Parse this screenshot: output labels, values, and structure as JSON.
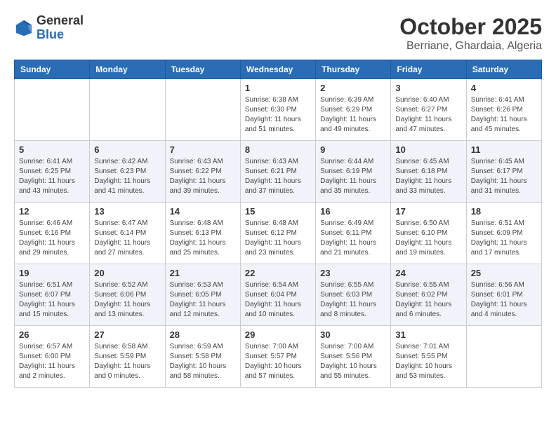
{
  "header": {
    "logo": {
      "line1": "General",
      "line2": "Blue"
    },
    "month": "October 2025",
    "location": "Berriane, Ghardaia, Algeria"
  },
  "weekdays": [
    "Sunday",
    "Monday",
    "Tuesday",
    "Wednesday",
    "Thursday",
    "Friday",
    "Saturday"
  ],
  "weeks": [
    [
      {
        "day": "",
        "info": ""
      },
      {
        "day": "",
        "info": ""
      },
      {
        "day": "",
        "info": ""
      },
      {
        "day": "1",
        "info": "Sunrise: 6:38 AM\nSunset: 6:30 PM\nDaylight: 11 hours\nand 51 minutes."
      },
      {
        "day": "2",
        "info": "Sunrise: 6:39 AM\nSunset: 6:29 PM\nDaylight: 11 hours\nand 49 minutes."
      },
      {
        "day": "3",
        "info": "Sunrise: 6:40 AM\nSunset: 6:27 PM\nDaylight: 11 hours\nand 47 minutes."
      },
      {
        "day": "4",
        "info": "Sunrise: 6:41 AM\nSunset: 6:26 PM\nDaylight: 11 hours\nand 45 minutes."
      }
    ],
    [
      {
        "day": "5",
        "info": "Sunrise: 6:41 AM\nSunset: 6:25 PM\nDaylight: 11 hours\nand 43 minutes."
      },
      {
        "day": "6",
        "info": "Sunrise: 6:42 AM\nSunset: 6:23 PM\nDaylight: 11 hours\nand 41 minutes."
      },
      {
        "day": "7",
        "info": "Sunrise: 6:43 AM\nSunset: 6:22 PM\nDaylight: 11 hours\nand 39 minutes."
      },
      {
        "day": "8",
        "info": "Sunrise: 6:43 AM\nSunset: 6:21 PM\nDaylight: 11 hours\nand 37 minutes."
      },
      {
        "day": "9",
        "info": "Sunrise: 6:44 AM\nSunset: 6:19 PM\nDaylight: 11 hours\nand 35 minutes."
      },
      {
        "day": "10",
        "info": "Sunrise: 6:45 AM\nSunset: 6:18 PM\nDaylight: 11 hours\nand 33 minutes."
      },
      {
        "day": "11",
        "info": "Sunrise: 6:45 AM\nSunset: 6:17 PM\nDaylight: 11 hours\nand 31 minutes."
      }
    ],
    [
      {
        "day": "12",
        "info": "Sunrise: 6:46 AM\nSunset: 6:16 PM\nDaylight: 11 hours\nand 29 minutes."
      },
      {
        "day": "13",
        "info": "Sunrise: 6:47 AM\nSunset: 6:14 PM\nDaylight: 11 hours\nand 27 minutes."
      },
      {
        "day": "14",
        "info": "Sunrise: 6:48 AM\nSunset: 6:13 PM\nDaylight: 11 hours\nand 25 minutes."
      },
      {
        "day": "15",
        "info": "Sunrise: 6:48 AM\nSunset: 6:12 PM\nDaylight: 11 hours\nand 23 minutes."
      },
      {
        "day": "16",
        "info": "Sunrise: 6:49 AM\nSunset: 6:11 PM\nDaylight: 11 hours\nand 21 minutes."
      },
      {
        "day": "17",
        "info": "Sunrise: 6:50 AM\nSunset: 6:10 PM\nDaylight: 11 hours\nand 19 minutes."
      },
      {
        "day": "18",
        "info": "Sunrise: 6:51 AM\nSunset: 6:09 PM\nDaylight: 11 hours\nand 17 minutes."
      }
    ],
    [
      {
        "day": "19",
        "info": "Sunrise: 6:51 AM\nSunset: 6:07 PM\nDaylight: 11 hours\nand 15 minutes."
      },
      {
        "day": "20",
        "info": "Sunrise: 6:52 AM\nSunset: 6:06 PM\nDaylight: 11 hours\nand 13 minutes."
      },
      {
        "day": "21",
        "info": "Sunrise: 6:53 AM\nSunset: 6:05 PM\nDaylight: 11 hours\nand 12 minutes."
      },
      {
        "day": "22",
        "info": "Sunrise: 6:54 AM\nSunset: 6:04 PM\nDaylight: 11 hours\nand 10 minutes."
      },
      {
        "day": "23",
        "info": "Sunrise: 6:55 AM\nSunset: 6:03 PM\nDaylight: 11 hours\nand 8 minutes."
      },
      {
        "day": "24",
        "info": "Sunrise: 6:55 AM\nSunset: 6:02 PM\nDaylight: 11 hours\nand 6 minutes."
      },
      {
        "day": "25",
        "info": "Sunrise: 6:56 AM\nSunset: 6:01 PM\nDaylight: 11 hours\nand 4 minutes."
      }
    ],
    [
      {
        "day": "26",
        "info": "Sunrise: 6:57 AM\nSunset: 6:00 PM\nDaylight: 11 hours\nand 2 minutes."
      },
      {
        "day": "27",
        "info": "Sunrise: 6:58 AM\nSunset: 5:59 PM\nDaylight: 11 hours\nand 0 minutes."
      },
      {
        "day": "28",
        "info": "Sunrise: 6:59 AM\nSunset: 5:58 PM\nDaylight: 10 hours\nand 58 minutes."
      },
      {
        "day": "29",
        "info": "Sunrise: 7:00 AM\nSunset: 5:57 PM\nDaylight: 10 hours\nand 57 minutes."
      },
      {
        "day": "30",
        "info": "Sunrise: 7:00 AM\nSunset: 5:56 PM\nDaylight: 10 hours\nand 55 minutes."
      },
      {
        "day": "31",
        "info": "Sunrise: 7:01 AM\nSunset: 5:55 PM\nDaylight: 10 hours\nand 53 minutes."
      },
      {
        "day": "",
        "info": ""
      }
    ]
  ]
}
